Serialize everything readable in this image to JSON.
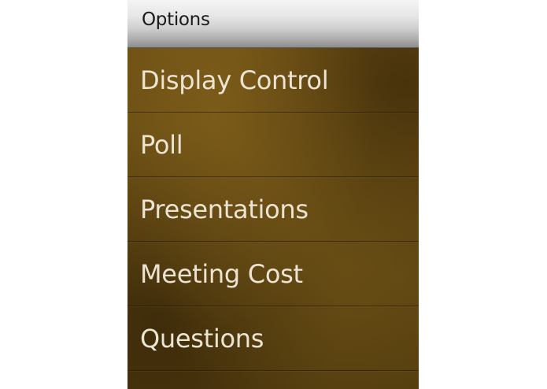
{
  "header": {
    "title": "Options"
  },
  "menu": {
    "items": [
      {
        "label": "Display Control"
      },
      {
        "label": "Poll"
      },
      {
        "label": "Presentations"
      },
      {
        "label": "Meeting Cost"
      },
      {
        "label": "Questions"
      }
    ]
  }
}
